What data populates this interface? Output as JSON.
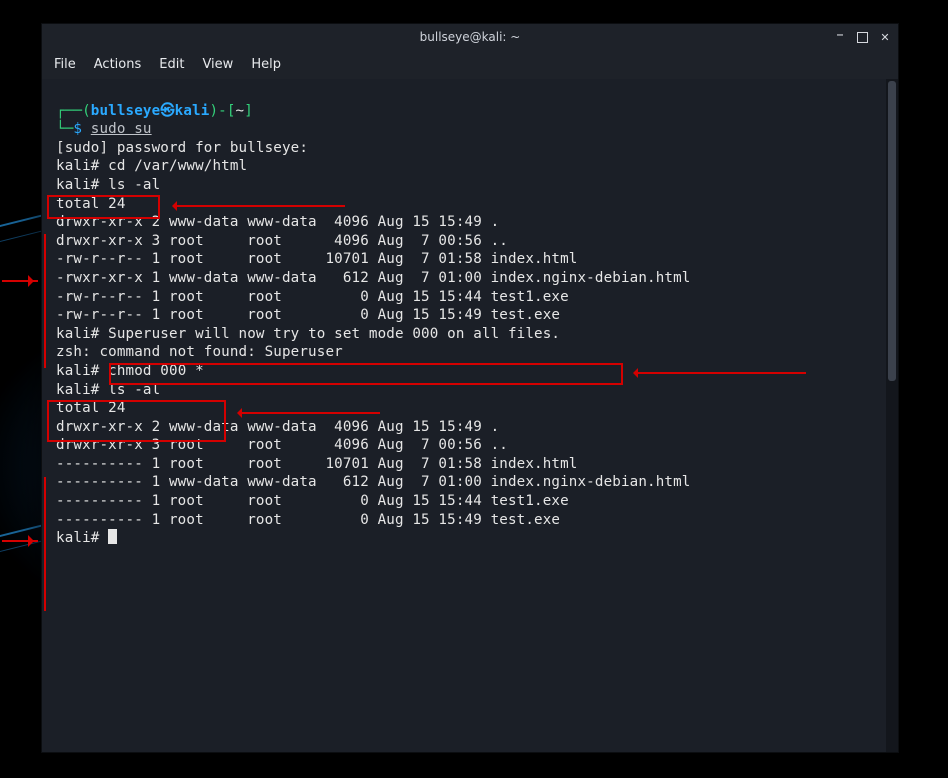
{
  "window": {
    "title": "bullseye@kali: ~"
  },
  "menu": {
    "file": "File",
    "actions": "Actions",
    "edit": "Edit",
    "view": "View",
    "help": "Help"
  },
  "prompt": {
    "l_seg1": "┌──(",
    "user": "bullseye",
    "skull": "㉿",
    "host": "kali",
    "l_seg2": ")-[",
    "cwd": "~",
    "l_seg3": "]",
    "l2_prefix": "└─",
    "dollar": "$ "
  },
  "cmd": {
    "sudo_su": "sudo su",
    "cd": "cd /var/www/html",
    "ls": "ls -al",
    "chmod": "chmod 000 *",
    "super_msg": "Superuser will now try to set mode 000 on all files."
  },
  "rootprompt": "kali# ",
  "out": {
    "sudo_pw": "[sudo] password for bullseye:",
    "total": "total 24",
    "zsh_err": "zsh: command not found: Superuser"
  },
  "ls1": [
    "drwxr-xr-x 2 www-data www-data  4096 Aug 15 15:49 .",
    "drwxr-xr-x 3 root     root      4096 Aug  7 00:56 ..",
    "-rw-r--r-- 1 root     root     10701 Aug  7 01:58 index.html",
    "-rwxr-xr-x 1 www-data www-data   612 Aug  7 01:00 index.nginx-debian.html",
    "-rw-r--r-- 1 root     root         0 Aug 15 15:44 test1.exe",
    "-rw-r--r-- 1 root     root         0 Aug 15 15:49 test.exe"
  ],
  "ls2": [
    "drwxr-xr-x 2 www-data www-data  4096 Aug 15 15:49 .",
    "drwxr-xr-x 3 root     root      4096 Aug  7 00:56 ..",
    "---------- 1 root     root     10701 Aug  7 01:58 index.html",
    "---------- 1 www-data www-data   612 Aug  7 01:00 index.nginx-debian.html",
    "---------- 1 root     root         0 Aug 15 15:44 test1.exe",
    "---------- 1 root     root         0 Aug 15 15:49 test.exe"
  ]
}
